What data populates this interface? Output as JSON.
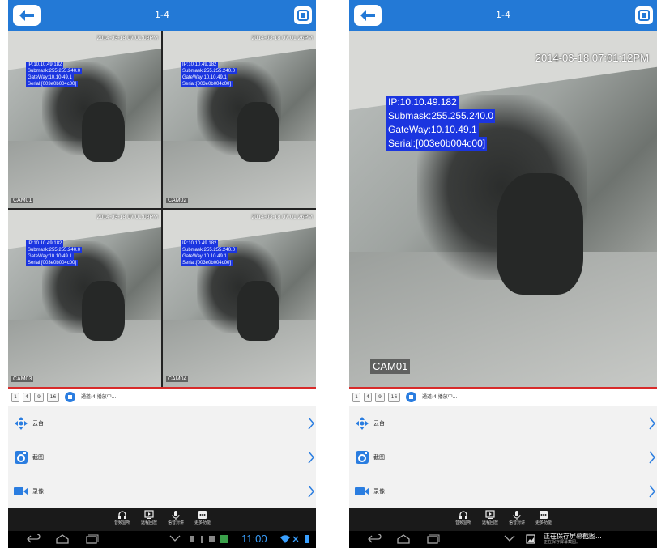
{
  "screens": {
    "left": {
      "title": "1-4",
      "cams": [
        {
          "timestamp": "2014-03-18 07:01:08PM",
          "ip": "IP:10.10.49.182",
          "submask": "Submask:255.255.240.0",
          "gateway": "GateWay:10.10.49.1",
          "serial": "Serial:[003e0b004c00]",
          "label": "CAM01"
        },
        {
          "timestamp": "2014-03-18 07:01:26PM",
          "ip": "IP:10.10.49.182",
          "submask": "Submask:255.255.240.0",
          "gateway": "GateWay:10.10.49.1",
          "serial": "Serial:[003e0b004c00]",
          "label": "CAM02"
        },
        {
          "timestamp": "2014-03-18 07:01:08PM",
          "ip": "IP:10.10.49.182",
          "submask": "Submask:255.255.240.0",
          "gateway": "GateWay:10.10.49.1",
          "serial": "Serial:[003e0b004c00]",
          "label": "CAM03"
        },
        {
          "timestamp": "2014-03-18 07:01:26PM",
          "ip": "IP:10.10.49.182",
          "submask": "Submask:255.255.240.0",
          "gateway": "GateWay:10.10.49.1",
          "serial": "Serial:[003e0b004c00]",
          "label": "CAM04"
        }
      ],
      "clock": "11:00"
    },
    "right": {
      "title": "1-4",
      "cam": {
        "timestamp": "2014-03-18 07:01:12PM",
        "ip": "IP:10.10.49.182",
        "submask": "Submask:255.255.240.0",
        "gateway": "GateWay:10.10.49.1",
        "serial": "Serial:[003e0b004c00]",
        "label": "CAM01"
      },
      "notification": "正在保存屏幕截图...",
      "notification_sub": "正在保存屏幕截图。"
    }
  },
  "channels": [
    "1",
    "4",
    "9",
    "16"
  ],
  "status": "通道:4 播放中...",
  "menu": {
    "ptz": "云台",
    "snapshot": "截图",
    "record": "录像"
  },
  "toolbar": {
    "audio": "音频监听",
    "playback": "远程回放",
    "talk": "语音对讲",
    "more": "更多功能"
  },
  "colors": {
    "accent": "#2379d6",
    "overlay_blue": "#1b35e0",
    "clock": "#3aa0ff",
    "divider_red": "#d82b2b"
  },
  "icons": [
    "back-arrow-icon",
    "fullscreen-icon",
    "ptz-arrows-icon",
    "camera-icon",
    "video-camera-icon",
    "chevron-right-icon",
    "headphones-icon",
    "playback-icon",
    "microphone-icon",
    "more-icon"
  ]
}
